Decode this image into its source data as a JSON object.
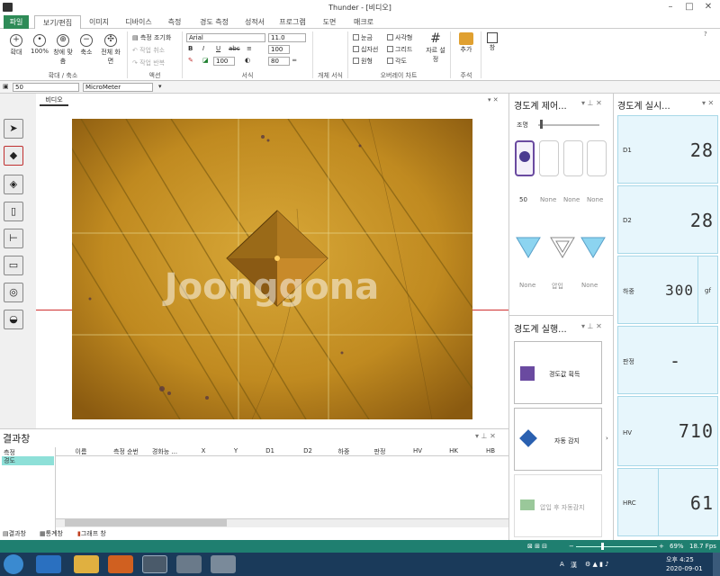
{
  "window": {
    "title": "Thunder - [비디오]"
  },
  "tabs": [
    {
      "label": "파일"
    },
    {
      "label": "보기/편집"
    },
    {
      "label": "이미지"
    },
    {
      "label": "디바이스"
    },
    {
      "label": "측정"
    },
    {
      "label": "경도 측정"
    },
    {
      "label": "성적서"
    },
    {
      "label": "프로그램"
    },
    {
      "label": "도면"
    },
    {
      "label": "매크로"
    }
  ],
  "ribbon": {
    "zoom": {
      "in": "확대",
      "pct": "100%",
      "fit": "창에 맞춤",
      "out": "축소",
      "full": "전체 화면",
      "group": "확대 / 축소"
    },
    "action": {
      "measure": "측정 조기화",
      "undo": "작업 취소",
      "redo": "작업 반복",
      "group": "액션"
    },
    "format": {
      "font": "Arial",
      "size": "11.0",
      "bold": "B",
      "italic": "I",
      "underline": "U",
      "strike": "abc",
      "pct": "100",
      "pct2": "100",
      "pct3": "80",
      "group": "서식"
    },
    "object_group": "개체 서식",
    "overlay": {
      "items": [
        "눈금",
        "사각형",
        "십자선",
        "그리드",
        "원형",
        "각도"
      ],
      "grid_label": "자르 설정",
      "group": "오버레이 차트"
    },
    "annot": {
      "add": "추가",
      "group": "주석"
    },
    "window": {
      "label": "창"
    }
  },
  "toolbar2": {
    "zoom": "50",
    "unit": "MicroMeter"
  },
  "video": {
    "tab": "비디오",
    "watermark": "Joonggona"
  },
  "control": {
    "title": "경도계 제어...",
    "light": "조명",
    "lens": [
      {
        "label": "50"
      },
      {
        "label": "None"
      },
      {
        "label": "None"
      },
      {
        "label": "None"
      }
    ],
    "indenter": [
      {
        "label": "None"
      },
      {
        "label": "압입"
      },
      {
        "label": "None"
      }
    ]
  },
  "exec": {
    "title": "경도계 실행...",
    "btn1": "경도값 획득",
    "btn2": "자동 감지",
    "btn3": "압입 후 자동감지"
  },
  "live": {
    "title": "경도계 실시...",
    "rows": [
      {
        "label": "D1",
        "value": "28"
      },
      {
        "label": "D2",
        "value": "28"
      },
      {
        "label": "하중",
        "value": "300",
        "unit": "gf"
      },
      {
        "label": "판정",
        "value": "-"
      },
      {
        "label": "HV",
        "value": "710"
      },
      {
        "label": "HRC",
        "value": "61"
      }
    ]
  },
  "results": {
    "title": "결과창",
    "tree": [
      "측정",
      "경도"
    ],
    "columns": [
      "이름",
      "측정 순번",
      "경화능 ...",
      "X",
      "Y",
      "D1",
      "D2",
      "하중",
      "판정",
      "HV",
      "HK",
      "HB"
    ],
    "bottom_tabs": [
      "결과창",
      "통계창",
      "그래프 창"
    ]
  },
  "status": {
    "zoom": "69%",
    "fps": "18.7 Fps"
  },
  "taskbar": {
    "lang": "A",
    "ime": "漢",
    "time": "오후 4:25",
    "date": "2020-09-01"
  }
}
